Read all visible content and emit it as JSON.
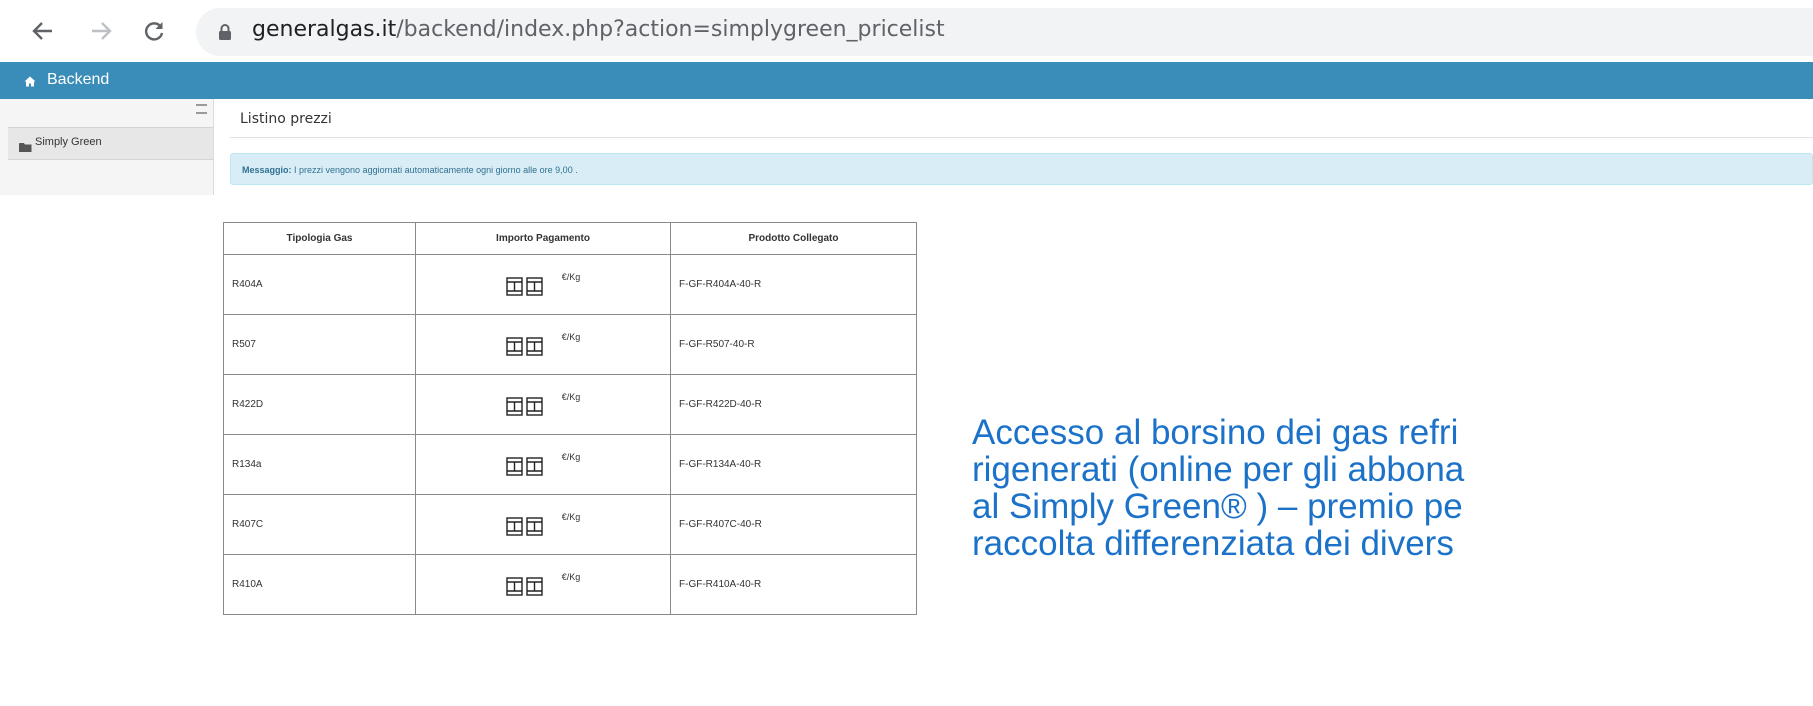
{
  "browser": {
    "url_domain": "generalgas.it",
    "url_path": "/backend/index.php?action=simplygreen_pricelist"
  },
  "topbar": {
    "title": "Backend"
  },
  "sidebar": {
    "items": [
      {
        "label": "Simply Green"
      }
    ]
  },
  "main": {
    "page_title": "Listino prezzi",
    "message_label": "Messaggio:",
    "message_text": " I prezzi vengono aggiornati automaticamente ogni giorno alle ore 9,00 ."
  },
  "table": {
    "headers": [
      "Tipologia Gas",
      "Importo Pagamento",
      "Prodotto Collegato"
    ],
    "rows": [
      {
        "gas": "R404A",
        "unit": "€/Kg",
        "product": "F-GF-R404A-40-R"
      },
      {
        "gas": "R507",
        "unit": "€/Kg",
        "product": "F-GF-R507-40-R"
      },
      {
        "gas": "R422D",
        "unit": "€/Kg",
        "product": "F-GF-R422D-40-R"
      },
      {
        "gas": "R134a",
        "unit": "€/Kg",
        "product": "F-GF-R134A-40-R"
      },
      {
        "gas": "R407C",
        "unit": "€/Kg",
        "product": "F-GF-R407C-40-R"
      },
      {
        "gas": "R410A",
        "unit": "€/Kg",
        "product": "F-GF-R410A-40-R"
      }
    ]
  },
  "caption": {
    "lines": [
      "Accesso al borsino dei gas refri",
      "rigenerati (online per gli abbona",
      "al Simply Green® ) – premio pe",
      "raccolta differenziata dei divers"
    ]
  },
  "colors": {
    "topbar": "#3a8cb9",
    "alert_bg": "#d9edf7",
    "caption": "#1b72c8"
  },
  "icons": [
    "back-arrow-icon",
    "forward-arrow-icon",
    "reload-icon",
    "lock-icon",
    "home-icon",
    "folder-icon"
  ]
}
